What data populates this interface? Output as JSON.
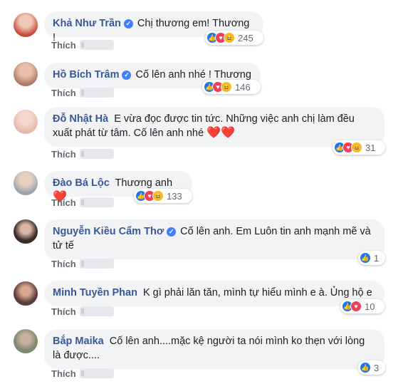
{
  "comments": [
    {
      "name": "Khả Như Trần",
      "verified": true,
      "text": "Chị thương em! Thương !",
      "action": "Thích",
      "reaction_count": "245",
      "reactions": [
        "like",
        "love",
        "haha"
      ],
      "avatar_color": "#c8473a"
    },
    {
      "name": "Hồ Bích Trâm",
      "verified": true,
      "text": "Cố lên anh nhé ! Thương",
      "action": "Thích",
      "reaction_count": "146",
      "reactions": [
        "like",
        "love",
        "haha"
      ],
      "avatar_color": "#b07a6a"
    },
    {
      "name": "Đỗ Nhật Hà",
      "verified": false,
      "text": "E vừa đọc được tin tức. Những việc anh chị làm đều",
      "text2": "xuất phát từ tâm. Cố lên anh nhé",
      "hearts": "❤️❤️",
      "action": "Thích",
      "reaction_count": "31",
      "reactions": [
        "like",
        "love",
        "haha"
      ],
      "avatar_color": "#e4b8a8"
    },
    {
      "name": "Đào Bá Lộc",
      "verified": false,
      "text": "Thương anh",
      "hearts": "❤️",
      "action": "Thích",
      "reaction_count": "133",
      "reactions": [
        "like",
        "love",
        "haha"
      ],
      "avatar_color": "#9aa3ad"
    },
    {
      "name": "Nguyễn Kiều Cẩm Thơ",
      "verified": true,
      "text": "Cố lên anh. Em Luôn tin anh mạnh mẽ và",
      "text2": "tử tế",
      "action": "Thích",
      "reaction_count": "1",
      "reactions": [
        "like"
      ],
      "avatar_color": "#3b2a26"
    },
    {
      "name": "Minh Tuyền Phan",
      "verified": false,
      "text": "K gì phải lăn tăn, mình tự hiểu mình e à. Ủng hộ e",
      "action": "Thích",
      "reaction_count": "10",
      "reactions": [
        "like",
        "love"
      ],
      "avatar_color": "#5a3e3a"
    },
    {
      "name": "Bắp Maika",
      "verified": false,
      "text": "Cố lên anh....mặc kệ người ta nói mình ko thẹn với lòng",
      "text2": "là được....",
      "action": "Thích",
      "reaction_count": "3",
      "reactions": [
        "like"
      ],
      "avatar_color": "#7d8a70"
    }
  ],
  "icons": {
    "like": "like-icon",
    "love": "love-icon",
    "haha": "haha-icon",
    "verified": "verified-badge-icon"
  }
}
